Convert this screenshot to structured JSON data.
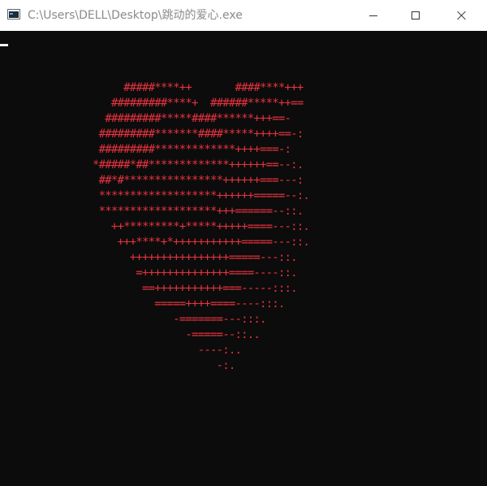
{
  "window": {
    "title": "C:\\Users\\DELL\\Desktop\\跳动的爱心.exe",
    "heart_color": "#e8333f",
    "background_color": "#0c0c0c",
    "controls": {
      "minimize": "minimize-icon",
      "maximize": "maximize-icon",
      "close": "close-icon"
    }
  },
  "console": {
    "heart_rows": [
      "     #####****++       ####****+++",
      "   #########****+  ######*****++==",
      "  #########*****####******+++==-",
      " #########*******####*****++++==-:",
      " #########*************++++===-:",
      "*#####*##*************++++++==--:.",
      " ##*#****************++++++===---:",
      " *******************++++++=====--:.",
      " *******************+++======--::.",
      "   ++*********+*****+++++====---::.",
      "    +++****+*+++++++++++=====---::.",
      "      ++++++++++++++++=====---::.",
      "       =++++++++++++++====----::.",
      "        ==+++++++++++===-----:::.",
      "          =====++++====----:::.",
      "             -=======---:::.",
      "               -=====--::..",
      "                 ----:..",
      "                    -:."
    ]
  }
}
